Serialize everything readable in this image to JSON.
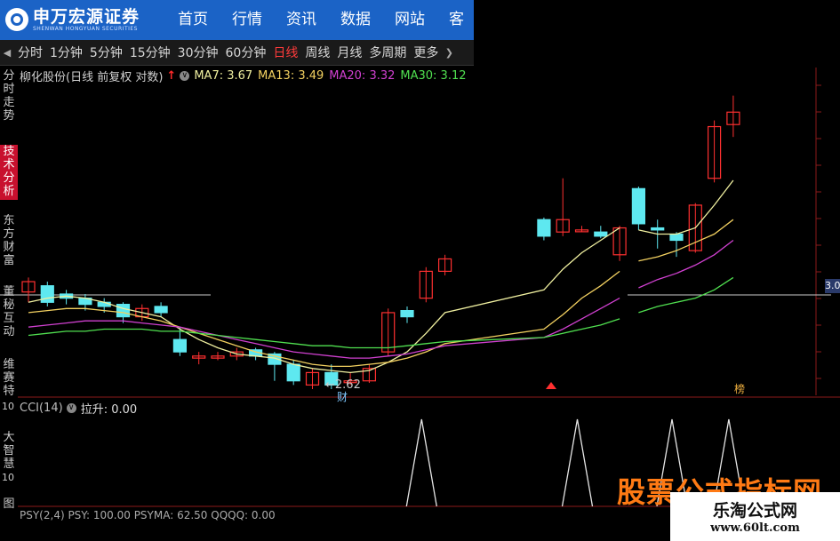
{
  "header": {
    "brand_name": "申万宏源证券",
    "brand_sub": "SHENWAN HONGYUAN SECURITIES",
    "nav": [
      "首页",
      "行情",
      "资讯",
      "数据",
      "网站",
      "客"
    ]
  },
  "toolbar": {
    "timeframes": [
      "分时",
      "1分钟",
      "5分钟",
      "15分钟",
      "30分钟",
      "60分钟",
      "日线",
      "周线",
      "月线",
      "多周期",
      "更多"
    ],
    "active": "日线"
  },
  "sidebar": {
    "tabs": [
      "分时走势",
      "技术分析",
      "东方财富",
      "董秘互动",
      "维赛特"
    ],
    "active": "技术分析",
    "num_top": "10",
    "num_mid": "10",
    "tab_bottom": "大智慧",
    "tab_last": "图"
  },
  "stock": {
    "name": "柳化股份(日线 前复权 对数)",
    "ma": [
      {
        "label": "MA7: 3.67",
        "color": "#f0f0a0"
      },
      {
        "label": "MA13: 3.49",
        "color": "#f2d060"
      },
      {
        "label": "MA20: 3.32",
        "color": "#d040d0"
      },
      {
        "label": "MA30: 3.12",
        "color": "#50e050"
      }
    ],
    "low_label": "←2.62",
    "marker_cai": "财",
    "marker_bang": "榜",
    "price_tag": "3.0"
  },
  "indicator": {
    "cci_name": "CCI(14)",
    "cci_value": "拉升: 0.00",
    "psy_line": "PSY(2,4)  PSY: 100.00  PSYMA: 62.50  QQQQ: 0.00"
  },
  "watermark": {
    "line1": "股票公式指标网",
    "line2": "乐淘公式网",
    "line3": "www.60lt.com"
  },
  "colors": {
    "up": "#ff3030",
    "down": "#5ee8f0",
    "brand": "#1b63c6",
    "active_tab": "#c8102e"
  },
  "chart_data": {
    "type": "candlestick",
    "candles": [
      {
        "o": 3.05,
        "c": 3.1,
        "h": 3.12,
        "l": 3.0
      },
      {
        "o": 3.08,
        "c": 3.0,
        "h": 3.1,
        "l": 2.98
      },
      {
        "o": 3.04,
        "c": 3.02,
        "h": 3.06,
        "l": 2.99
      },
      {
        "o": 3.02,
        "c": 2.99,
        "h": 3.04,
        "l": 2.96
      },
      {
        "o": 3.0,
        "c": 2.98,
        "h": 3.02,
        "l": 2.95
      },
      {
        "o": 2.99,
        "c": 2.93,
        "h": 3.0,
        "l": 2.9
      },
      {
        "o": 2.93,
        "c": 2.97,
        "h": 2.99,
        "l": 2.91
      },
      {
        "o": 2.98,
        "c": 2.95,
        "h": 3.0,
        "l": 2.93
      },
      {
        "o": 2.82,
        "c": 2.76,
        "h": 2.88,
        "l": 2.74
      },
      {
        "o": 2.73,
        "c": 2.74,
        "h": 2.76,
        "l": 2.7
      },
      {
        "o": 2.73,
        "c": 2.74,
        "h": 2.76,
        "l": 2.72
      },
      {
        "o": 2.74,
        "c": 2.76,
        "h": 2.78,
        "l": 2.72
      },
      {
        "o": 2.77,
        "c": 2.74,
        "h": 2.78,
        "l": 2.72
      },
      {
        "o": 2.75,
        "c": 2.7,
        "h": 2.76,
        "l": 2.62
      },
      {
        "o": 2.7,
        "c": 2.62,
        "h": 2.72,
        "l": 2.6
      },
      {
        "o": 2.6,
        "c": 2.66,
        "h": 2.68,
        "l": 2.58
      },
      {
        "o": 2.66,
        "c": 2.6,
        "h": 2.7,
        "l": 2.58
      },
      {
        "o": 2.62,
        "c": 2.62,
        "h": 2.66,
        "l": 2.6
      },
      {
        "o": 2.62,
        "c": 2.68,
        "h": 2.7,
        "l": 2.61
      },
      {
        "o": 2.76,
        "c": 2.95,
        "h": 2.97,
        "l": 2.74
      },
      {
        "o": 2.96,
        "c": 2.93,
        "h": 2.98,
        "l": 2.9
      },
      {
        "o": 3.02,
        "c": 3.15,
        "h": 3.17,
        "l": 3.0
      },
      {
        "o": 3.15,
        "c": 3.21,
        "h": 3.23,
        "l": 3.13
      },
      {
        "o": 3.4,
        "c": 3.32,
        "h": 3.41,
        "l": 3.3
      },
      {
        "o": 3.34,
        "c": 3.4,
        "h": 3.6,
        "l": 3.32
      },
      {
        "o": 3.35,
        "c": 3.35,
        "h": 3.37,
        "l": 3.34
      },
      {
        "o": 3.34,
        "c": 3.32,
        "h": 3.37,
        "l": 3.31
      },
      {
        "o": 3.23,
        "c": 3.36,
        "h": 3.37,
        "l": 3.2
      },
      {
        "o": 3.55,
        "c": 3.38,
        "h": 3.56,
        "l": 3.35
      },
      {
        "o": 3.36,
        "c": 3.35,
        "h": 3.4,
        "l": 3.26
      },
      {
        "o": 3.33,
        "c": 3.3,
        "h": 3.34,
        "l": 3.22
      },
      {
        "o": 3.25,
        "c": 3.47,
        "h": 3.48,
        "l": 3.24
      },
      {
        "o": 3.6,
        "c": 3.85,
        "h": 3.88,
        "l": 3.58
      },
      {
        "o": 3.86,
        "c": 3.92,
        "h": 4.0,
        "l": 3.8
      }
    ],
    "ma7": [
      3.0,
      3.02,
      3.03,
      3.02,
      3.0,
      2.97,
      2.95,
      2.93,
      2.87,
      2.82,
      2.78,
      2.75,
      2.74,
      2.73,
      2.7,
      2.68,
      2.67,
      2.66,
      2.67,
      2.71,
      2.76,
      2.85,
      2.95,
      3.06,
      3.16,
      3.24,
      3.3,
      3.36,
      3.35,
      3.33,
      3.33,
      3.36,
      3.47,
      3.59
    ],
    "ma13": [
      2.95,
      2.96,
      2.97,
      2.97,
      2.96,
      2.95,
      2.93,
      2.91,
      2.88,
      2.85,
      2.82,
      2.79,
      2.76,
      2.74,
      2.72,
      2.7,
      2.69,
      2.69,
      2.7,
      2.71,
      2.73,
      2.76,
      2.8,
      2.87,
      2.94,
      3.02,
      3.08,
      3.15,
      3.2,
      3.22,
      3.25,
      3.29,
      3.33,
      3.4
    ],
    "ma20": [
      2.88,
      2.89,
      2.9,
      2.91,
      2.91,
      2.91,
      2.9,
      2.89,
      2.88,
      2.86,
      2.84,
      2.82,
      2.8,
      2.78,
      2.76,
      2.75,
      2.74,
      2.73,
      2.73,
      2.74,
      2.75,
      2.77,
      2.79,
      2.83,
      2.87,
      2.92,
      2.97,
      3.02,
      3.07,
      3.11,
      3.14,
      3.18,
      3.23,
      3.3
    ],
    "ma30": [
      2.84,
      2.85,
      2.86,
      2.86,
      2.87,
      2.87,
      2.87,
      2.86,
      2.86,
      2.85,
      2.84,
      2.83,
      2.82,
      2.81,
      2.8,
      2.79,
      2.79,
      2.78,
      2.78,
      2.78,
      2.79,
      2.8,
      2.81,
      2.83,
      2.85,
      2.87,
      2.89,
      2.92,
      2.95,
      2.98,
      3.0,
      3.02,
      3.06,
      3.12
    ],
    "cci_spikes": [
      21,
      25,
      30,
      33
    ],
    "ylim": [
      2.55,
      4.05
    ]
  }
}
